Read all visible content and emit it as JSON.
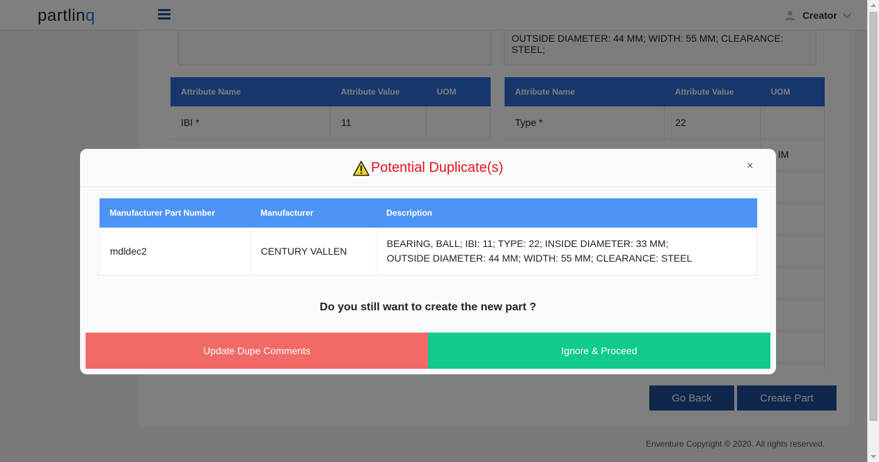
{
  "header": {
    "logo_main": "partlin",
    "logo_accent": "q",
    "user_name": "Creator"
  },
  "background": {
    "description_right": "OUTSIDE DIAMETER: 44 MM; WIDTH: 55 MM; CLEARANCE: STEEL;",
    "left_table": {
      "headers": [
        "Attribute Name",
        "Attribute Value",
        "UOM"
      ],
      "rows": [
        {
          "name": "IBI *",
          "value": "11",
          "uom": ""
        }
      ]
    },
    "right_table": {
      "headers": [
        "Attribute Name",
        "Attribute Value",
        "UOM"
      ],
      "rows": [
        {
          "name": "Type *",
          "value": "22",
          "uom": ""
        }
      ]
    },
    "partial_uom_text": "IM",
    "go_back_label": "Go Back",
    "create_part_label": "Create Part",
    "copyright": "Enventure Copyright © 2020. All rights reserved."
  },
  "modal": {
    "title": "Potential Duplicate(s)",
    "close_symbol": "×",
    "table": {
      "headers": [
        "Manufacturer Part Number",
        "Manufacturer",
        "Description"
      ],
      "rows": [
        {
          "part_number": "mdldec2",
          "manufacturer": "CENTURY VALLEN",
          "description_line1": "BEARING, BALL; IBI: 11; TYPE: 22; INSIDE DIAMETER: 33 MM;",
          "description_line2": "OUTSIDE DIAMETER: 44 MM; WIDTH: 55 MM; CLEARANCE: STEEL"
        }
      ]
    },
    "question": "Do you still want to create the new part ?",
    "update_button_label": "Update Dupe Comments",
    "ignore_button_label": "Ignore & Proceed"
  },
  "colors": {
    "brand_blue": "#2e6fd6",
    "dark_blue": "#1f4f9a",
    "modal_header_blue": "#4d93f6",
    "warning_red": "#e8141c",
    "update_red": "#f26a65",
    "proceed_green": "#12c98f"
  }
}
